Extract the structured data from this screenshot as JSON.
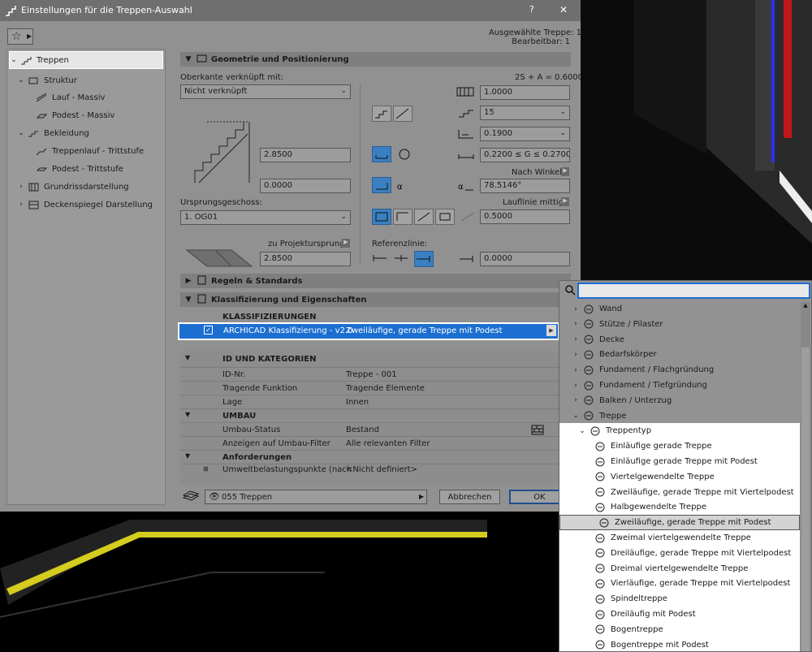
{
  "window": {
    "title": "Einstellungen für die Treppen-Auswahl",
    "help": "?",
    "close": "✕"
  },
  "selection_info": {
    "line1": "Ausgewählte Treppe: 1",
    "line2": "Bearbeitbar: 1"
  },
  "sidebar": {
    "items": [
      {
        "label": "Treppen"
      },
      {
        "label": "Struktur"
      },
      {
        "label": "Lauf - Massiv"
      },
      {
        "label": "Podest - Massiv"
      },
      {
        "label": "Bekleidung"
      },
      {
        "label": "Treppenlauf - Trittstufe"
      },
      {
        "label": "Podest - Trittstufe"
      },
      {
        "label": "Grundrissdarstellung"
      },
      {
        "label": "Deckenspiegel Darstellung"
      }
    ]
  },
  "geometry": {
    "header": "Geometrie und Positionierung",
    "top_link_label": "Oberkante verknüpft mit:",
    "top_link_value": "Nicht verknüpft",
    "formula": "2S + A = 0.6000",
    "height_value": "2.8500",
    "offset_value": "0.0000",
    "home_story_label": "Ursprungsgeschoss:",
    "home_story_value": "1. OG01",
    "to_project_zero_label": "zu Projektursprung",
    "project_zero_value": "2.8500",
    "width_value": "1.0000",
    "risers_value": "15",
    "riser_height_value": "0.1900",
    "going_range": "0.2200 ≤ G ≤ 0.2700",
    "angle_mode_label": "Nach Winkel",
    "angle_value": "78.5146°",
    "walkline_label": "Lauflinie mittig",
    "walkline_value": "0.5000",
    "reference_label": "Referenzlinie:",
    "reference_value": "0.0000"
  },
  "rules_header": "Regeln & Standards",
  "classification": {
    "header": "Klassifizierung und Eigenschaften",
    "section_label": "KLASSIFIZIERUNGEN",
    "system": "ARCHICAD Klassifizierung - v2.0",
    "value": "Zweiläufige, gerade Treppe mit Podest"
  },
  "properties": {
    "id_group": "ID UND KATEGORIEN",
    "rows": [
      {
        "key": "ID-Nr.",
        "value": "Treppe - 001"
      },
      {
        "key": "Tragende Funktion",
        "value": "Tragende Elemente"
      },
      {
        "key": "Lage",
        "value": "Innen"
      }
    ],
    "umbau_group": "UMBAU",
    "umbau_rows": [
      {
        "key": "Umbau-Status",
        "value": "Bestand"
      },
      {
        "key": "Anzeigen auf Umbau-Filter",
        "value": "Alle relevanten Filter"
      }
    ],
    "req_group": "Anforderungen",
    "req_rows": [
      {
        "key": "Umweltbelastungspunkte (nach",
        "value": "<Nicht definiert>"
      }
    ]
  },
  "footer": {
    "layer": "055 Treppen",
    "cancel": "Abbrechen",
    "ok": "OK"
  },
  "popup": {
    "search_placeholder": "",
    "items": [
      {
        "label": "Wand",
        "level": 0
      },
      {
        "label": "Stütze / Pilaster",
        "level": 0
      },
      {
        "label": "Decke",
        "level": 0
      },
      {
        "label": "Bedarfskörper",
        "level": 0
      },
      {
        "label": "Fundament / Flachgründung",
        "level": 0
      },
      {
        "label": "Fundament / Tiefgründung",
        "level": 0
      },
      {
        "label": "Balken / Unterzug",
        "level": 0
      },
      {
        "label": "Treppe",
        "level": 0
      },
      {
        "label": "Treppentyp",
        "level": 1
      },
      {
        "label": "Einläufige gerade Treppe",
        "level": 2
      },
      {
        "label": "Einläufige gerade Treppe mit Podest",
        "level": 2
      },
      {
        "label": "Viertelgewendelte Treppe",
        "level": 2
      },
      {
        "label": "Zweiläufige, gerade Treppe mit Viertelpodest",
        "level": 2
      },
      {
        "label": "Halbgewendelte Treppe",
        "level": 2
      },
      {
        "label": "Zweiläufige, gerade Treppe mit Podest",
        "level": 2
      },
      {
        "label": "Zweimal viertelgewendelte Treppe",
        "level": 2
      },
      {
        "label": "Dreiläufige, gerade Treppe mit Viertelpodest",
        "level": 2
      },
      {
        "label": "Dreimal viertelgewendelte Treppe",
        "level": 2
      },
      {
        "label": "Vierläufige, gerade Treppe mit Viertelpodest",
        "level": 2
      },
      {
        "label": "Spindeltreppe",
        "level": 2
      },
      {
        "label": "Dreiläufig mit Podest",
        "level": 2
      },
      {
        "label": "Bogentreppe",
        "level": 2
      },
      {
        "label": "Bogentreppe mit Podest",
        "level": 2
      }
    ]
  },
  "colors": {
    "accent": "#1c6fd1",
    "highlight": "#ffffff"
  }
}
